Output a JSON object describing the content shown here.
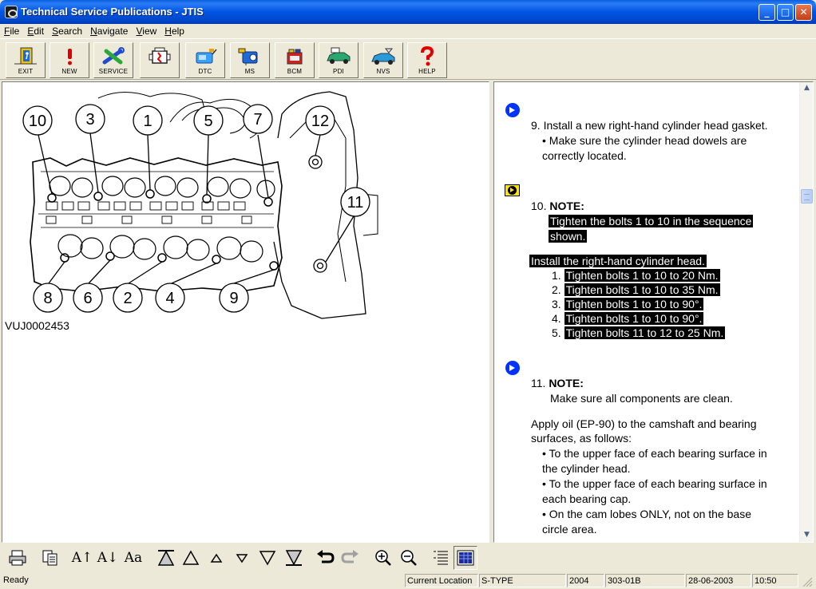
{
  "window": {
    "title": "Technical Service Publications - JTIS",
    "minimize": "_",
    "maximize": "□",
    "close": "✕"
  },
  "menu": [
    "File",
    "Edit",
    "Search",
    "Navigate",
    "View",
    "Help"
  ],
  "toolbar": [
    {
      "label": "EXIT",
      "icon": "exit-door-icon"
    },
    {
      "label": "NEW",
      "icon": "exclamation-icon"
    },
    {
      "label": "SERVICE",
      "icon": "service-tools-icon"
    },
    {
      "label": "",
      "icon": "engine-block-icon"
    },
    {
      "label": "DTC",
      "icon": "dtc-icon"
    },
    {
      "label": "MS",
      "icon": "ms-icon"
    },
    {
      "label": "BCM",
      "icon": "bcm-icon"
    },
    {
      "label": "PDI",
      "icon": "pdi-car-icon"
    },
    {
      "label": "NVS",
      "icon": "nvs-car-icon"
    },
    {
      "label": "HELP",
      "icon": "help-question-icon"
    }
  ],
  "figure": {
    "id": "VUJ0002453",
    "callouts_top": [
      "10",
      "3",
      "1",
      "5",
      "7",
      "12"
    ],
    "callout_right": "11",
    "callouts_bottom": [
      "8",
      "6",
      "2",
      "4",
      "9"
    ]
  },
  "document": {
    "step9": {
      "text": "9. Install a new right-hand cylinder head gasket.",
      "bullet_line1": "• Make sure the cylinder head dowels are",
      "bullet_line2": "correctly located."
    },
    "step10": {
      "prefix": "10. ",
      "note": "NOTE:",
      "note_line1": "Tighten the bolts 1 to 10 in the sequence",
      "note_line2": "shown.",
      "intro": "Install the right-hand cylinder head.",
      "substeps": [
        {
          "num": "1.",
          "text": "Tighten bolts 1 to 10 to 20 Nm."
        },
        {
          "num": "2.",
          "text": "Tighten bolts 1 to 10 to 35 Nm."
        },
        {
          "num": "3.",
          "text": "Tighten bolts 1 to 10 to 90°."
        },
        {
          "num": "4.",
          "text": "Tighten bolts 1 to 10 to 90°."
        },
        {
          "num": "5.",
          "text": "Tighten bolts 11 to 12 to 25 Nm."
        }
      ]
    },
    "step11": {
      "prefix": "11. ",
      "note": "NOTE:",
      "note_line": "Make sure all components are clean.",
      "apply_line1": "Apply oil (EP-90) to the camshaft and bearing",
      "apply_line2": "surfaces, as follows:",
      "bullets": [
        [
          "• To the upper face of each bearing surface in",
          "the cylinder head."
        ],
        [
          "• To the upper face of each bearing surface in",
          "each bearing cap."
        ],
        [
          "• On the cam lobes ONLY, not on the base",
          "circle area."
        ]
      ]
    }
  },
  "bottom_toolbar": [
    {
      "icon": "print-icon",
      "text": ""
    },
    {
      "icon": "copy-icon",
      "text": ""
    },
    {
      "icon": "font-larger-icon",
      "text": "A↑"
    },
    {
      "icon": "font-smaller-icon",
      "text": "A↓"
    },
    {
      "icon": "font-face-icon",
      "text": "Aa"
    },
    {
      "icon": "first-page-icon",
      "text": ""
    },
    {
      "icon": "previous-section-icon",
      "text": ""
    },
    {
      "icon": "previous-step-icon",
      "text": ""
    },
    {
      "icon": "next-step-icon",
      "text": ""
    },
    {
      "icon": "next-section-icon",
      "text": ""
    },
    {
      "icon": "last-page-icon",
      "text": ""
    },
    {
      "icon": "back-icon",
      "text": ""
    },
    {
      "icon": "forward-icon",
      "text": ""
    },
    {
      "icon": "zoom-in-icon",
      "text": ""
    },
    {
      "icon": "zoom-out-icon",
      "text": ""
    },
    {
      "icon": "text-only-view-icon",
      "text": ""
    },
    {
      "icon": "split-view-icon",
      "text": ""
    }
  ],
  "status": {
    "ready": "Ready",
    "location_label": "Current Location",
    "model": "S-TYPE",
    "year": "2004",
    "section": "303-01B",
    "date": "28-06-2003",
    "time": "10:50"
  },
  "colors": {
    "titlebar": "#0054e3",
    "marker_blue": "#0033ff",
    "note_yellow": "#ffe600",
    "highlight": "#000000"
  }
}
